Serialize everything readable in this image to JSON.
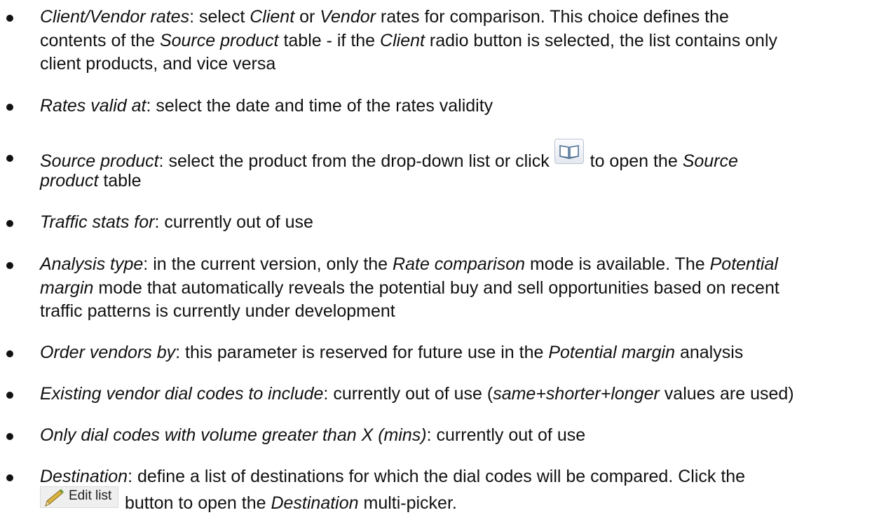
{
  "items": [
    {
      "parts": [
        [
          "i",
          "Client/Vendor rates"
        ],
        [
          "t",
          ": select "
        ],
        [
          "i",
          "Client"
        ],
        [
          "t",
          " or "
        ],
        [
          "i",
          "Vendor"
        ],
        [
          "t",
          " rates for comparison. This choice defines the"
        ]
      ],
      "line2": [
        [
          "t",
          "contents of the "
        ],
        [
          "i",
          "Source product"
        ],
        [
          "t",
          " table - if the "
        ],
        [
          "i",
          "Client"
        ],
        [
          "t",
          " radio button is selected, the list contains only"
        ]
      ],
      "line3": [
        [
          "t",
          "client products, and vice versa"
        ]
      ]
    },
    {
      "parts": [
        [
          "i",
          "Rates valid at"
        ],
        [
          "t",
          ": select the date and time of the rates validity"
        ]
      ]
    },
    {
      "parts": [
        [
          "i",
          "Source product"
        ],
        [
          "t",
          ": select the product from the drop-down list or click "
        ]
      ],
      "parts_after_icon": [
        [
          "t",
          " to open the "
        ],
        [
          "i",
          "Source"
        ]
      ],
      "line2": [
        [
          "i",
          "product"
        ],
        [
          "t",
          " table"
        ]
      ]
    },
    {
      "parts": [
        [
          "i",
          "Traffic stats for"
        ],
        [
          "t",
          ": currently out of use"
        ]
      ]
    },
    {
      "parts": [
        [
          "i",
          "Analysis type"
        ],
        [
          "t",
          ": in the current version, only the "
        ],
        [
          "i",
          "Rate comparison"
        ],
        [
          "t",
          " mode is available. The "
        ],
        [
          "i",
          "Potential"
        ]
      ],
      "line2": [
        [
          "i",
          "margin"
        ],
        [
          "t",
          " mode that automatically reveals the potential buy and sell opportunities based on recent"
        ]
      ],
      "line3": [
        [
          "t",
          "traffic patterns is currently under development"
        ]
      ]
    },
    {
      "parts": [
        [
          "i",
          "Order vendors by"
        ],
        [
          "t",
          ": this parameter is reserved for future use in the "
        ],
        [
          "i",
          "Potential margin"
        ],
        [
          "t",
          " analysis"
        ]
      ]
    },
    {
      "parts": [
        [
          "i",
          "Existing vendor dial codes to include"
        ],
        [
          "t",
          ": currently out of use ("
        ],
        [
          "i",
          "same+shorter+longer"
        ],
        [
          "t",
          " values are used)"
        ]
      ]
    },
    {
      "parts": [
        [
          "i",
          "Only dial codes with volume greater than X (mins)"
        ],
        [
          "t",
          ": currently out of use"
        ]
      ]
    },
    {
      "parts": [
        [
          "i",
          "Destination"
        ],
        [
          "t",
          ": define a list of destinations for which the dial codes will be compared. Click the"
        ]
      ],
      "line2_after_button": [
        [
          "t",
          " button to open the "
        ],
        [
          "i",
          "Destination"
        ],
        [
          "t",
          " multi-picker."
        ]
      ]
    }
  ],
  "edit_list_button": {
    "label": "Edit list",
    "icon": "pencil-icon"
  },
  "source_product_button": {
    "icon": "book-icon"
  }
}
